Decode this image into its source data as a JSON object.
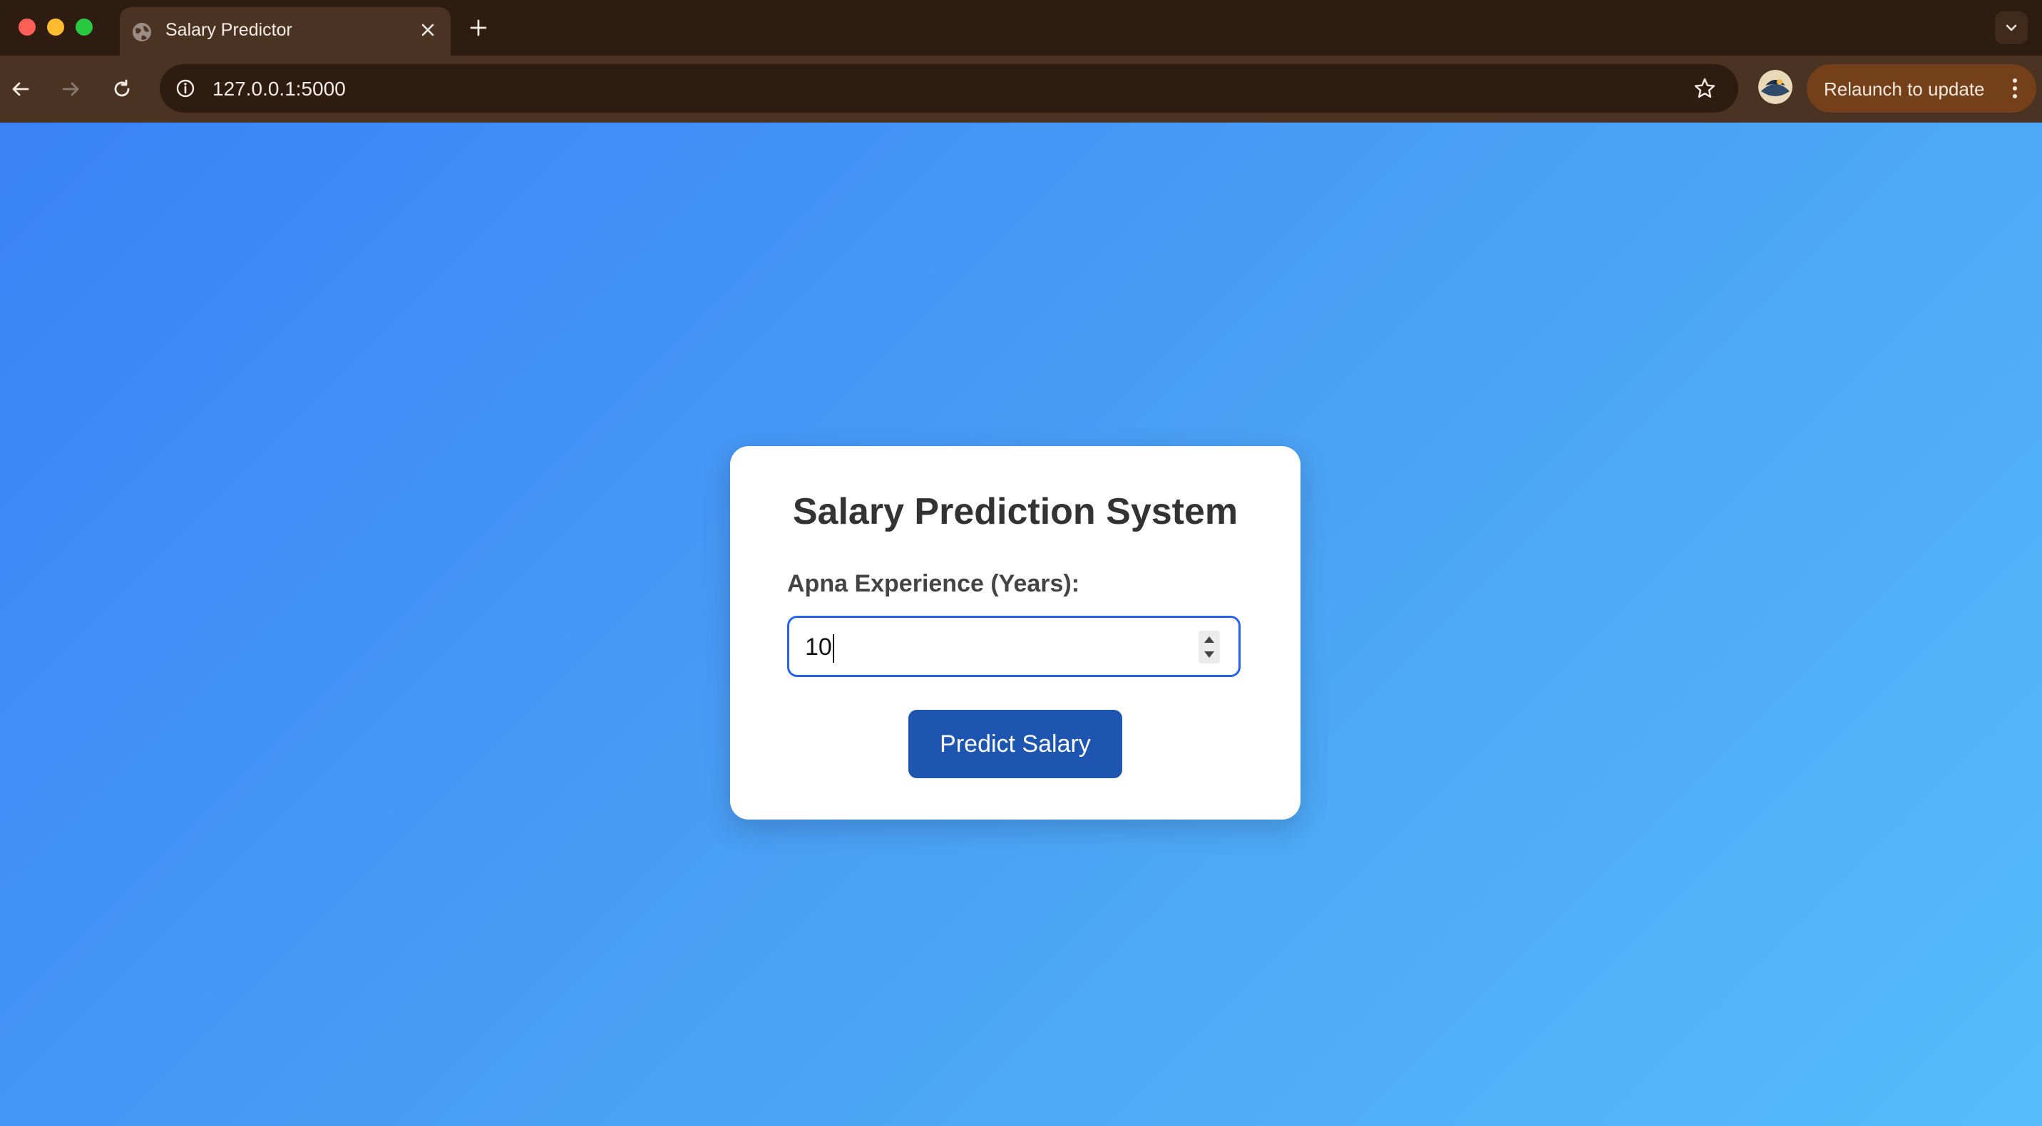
{
  "browser": {
    "tab": {
      "title": "Salary Predictor",
      "icon": "globe-icon",
      "close_icon": "close-icon"
    },
    "new_tab_icon": "plus-icon",
    "tab_search_icon": "chevron-down-icon",
    "toolbar": {
      "back_icon": "arrow-left-icon",
      "forward_icon": "arrow-right-icon",
      "reload_icon": "reload-icon",
      "site_info_icon": "info-icon",
      "url": "127.0.0.1:5000",
      "bookmark_icon": "star-icon",
      "profile_icon": "avatar",
      "relaunch_label": "Relaunch to update",
      "menu_icon": "kebab-menu-icon"
    },
    "colors": {
      "titlebar": "#2e1c10",
      "toolbar": "#4a3323",
      "relaunch_bg": "#74401a"
    }
  },
  "page": {
    "background_gradient": [
      "#3a82f6",
      "#55bdfa"
    ],
    "card": {
      "title": "Salary Prediction System",
      "field_label": "Apna Experience (Years):",
      "input_value": "10",
      "button_label": "Predict Salary",
      "button_color": "#1e55b0",
      "input_border_color": "#2563eb"
    }
  }
}
